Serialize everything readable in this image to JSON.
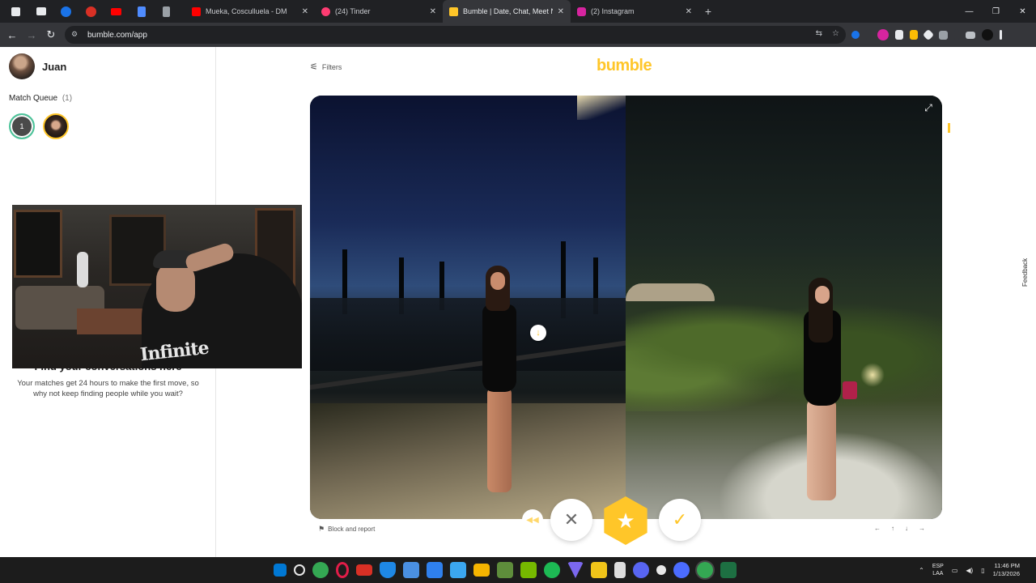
{
  "browser": {
    "pinned_tabs": [
      {
        "icon": "app-grid-icon",
        "color": "#e8eaed"
      },
      {
        "icon": "window-icon",
        "color": "#e8eaed"
      },
      {
        "icon": "c-logo-icon",
        "color": "#1a73e8"
      },
      {
        "icon": "red-shield-icon",
        "color": "#d93025"
      },
      {
        "icon": "youtube-icon",
        "color": "#ff0000"
      },
      {
        "icon": "meta-icon",
        "color": "#4f8cff"
      },
      {
        "icon": "tools-icon",
        "color": "#e8eaed"
      }
    ],
    "tabs": [
      {
        "title": "Mueka, Cosculluela - DM",
        "favicon_color": "#ff0000",
        "active": false
      },
      {
        "title": "(24) Tinder",
        "favicon_color": "#fe3c72",
        "active": false
      },
      {
        "title": "Bumble | Date, Chat, Meet New",
        "favicon_color": "#ffc629",
        "active": true
      },
      {
        "title": "(2) Instagram",
        "favicon_color": "#d6249f",
        "active": false
      }
    ],
    "new_tab_label": "+",
    "url": "bumble.com/app",
    "extension_colors": [
      "#1a73e8",
      "#e8eaed",
      "#d6249f",
      "#e8eaed",
      "#fbbc04",
      "#e8eaed",
      "#e8eaed",
      "#e8eaed",
      "#111111"
    ]
  },
  "sidebar": {
    "user_name": "Juan",
    "match_queue_label": "Match Queue",
    "match_queue_count": "(1)",
    "queue_bubble_count": "1",
    "empty_title": "Find your conversations here",
    "empty_text": "Your matches get 24 hours to make the first move, so why not keep finding people while you wait?"
  },
  "webcam": {
    "shirt_text": "Infinite"
  },
  "main": {
    "filters_label": "Filters",
    "brand": "bumble",
    "block_report_label": "Block and report",
    "feedback_label": "Feedback",
    "actions": {
      "back": "rewind",
      "pass": "pass",
      "superswipe": "superswipe",
      "like": "like"
    },
    "pager_icons": [
      "arrow-left",
      "arrow-up",
      "arrow-down",
      "arrow-right"
    ]
  },
  "colors": {
    "brand_yellow": "#ffc629",
    "chrome_dark": "#202124",
    "chrome_toolbar": "#35363a"
  },
  "taskbar": {
    "language_line1": "ESP",
    "language_line2": "LAA",
    "time": "11:46 PM",
    "date": "1/13/2026",
    "icon_colors": [
      "#0078d4",
      "#e8e8e8",
      "#34a853",
      "#e11d48",
      "#d93025",
      "#1e88e5",
      "#4a90e2",
      "#2f80ed",
      "#3ba7f0",
      "#f5b400",
      "#5e8d3b",
      "#76b900",
      "#1db954",
      "#7b68ee",
      "#f0c419",
      "#dddddd",
      "#5865f2",
      "#e8e8e8",
      "#4b6cff",
      "#34a853",
      "#1d6f42"
    ]
  }
}
